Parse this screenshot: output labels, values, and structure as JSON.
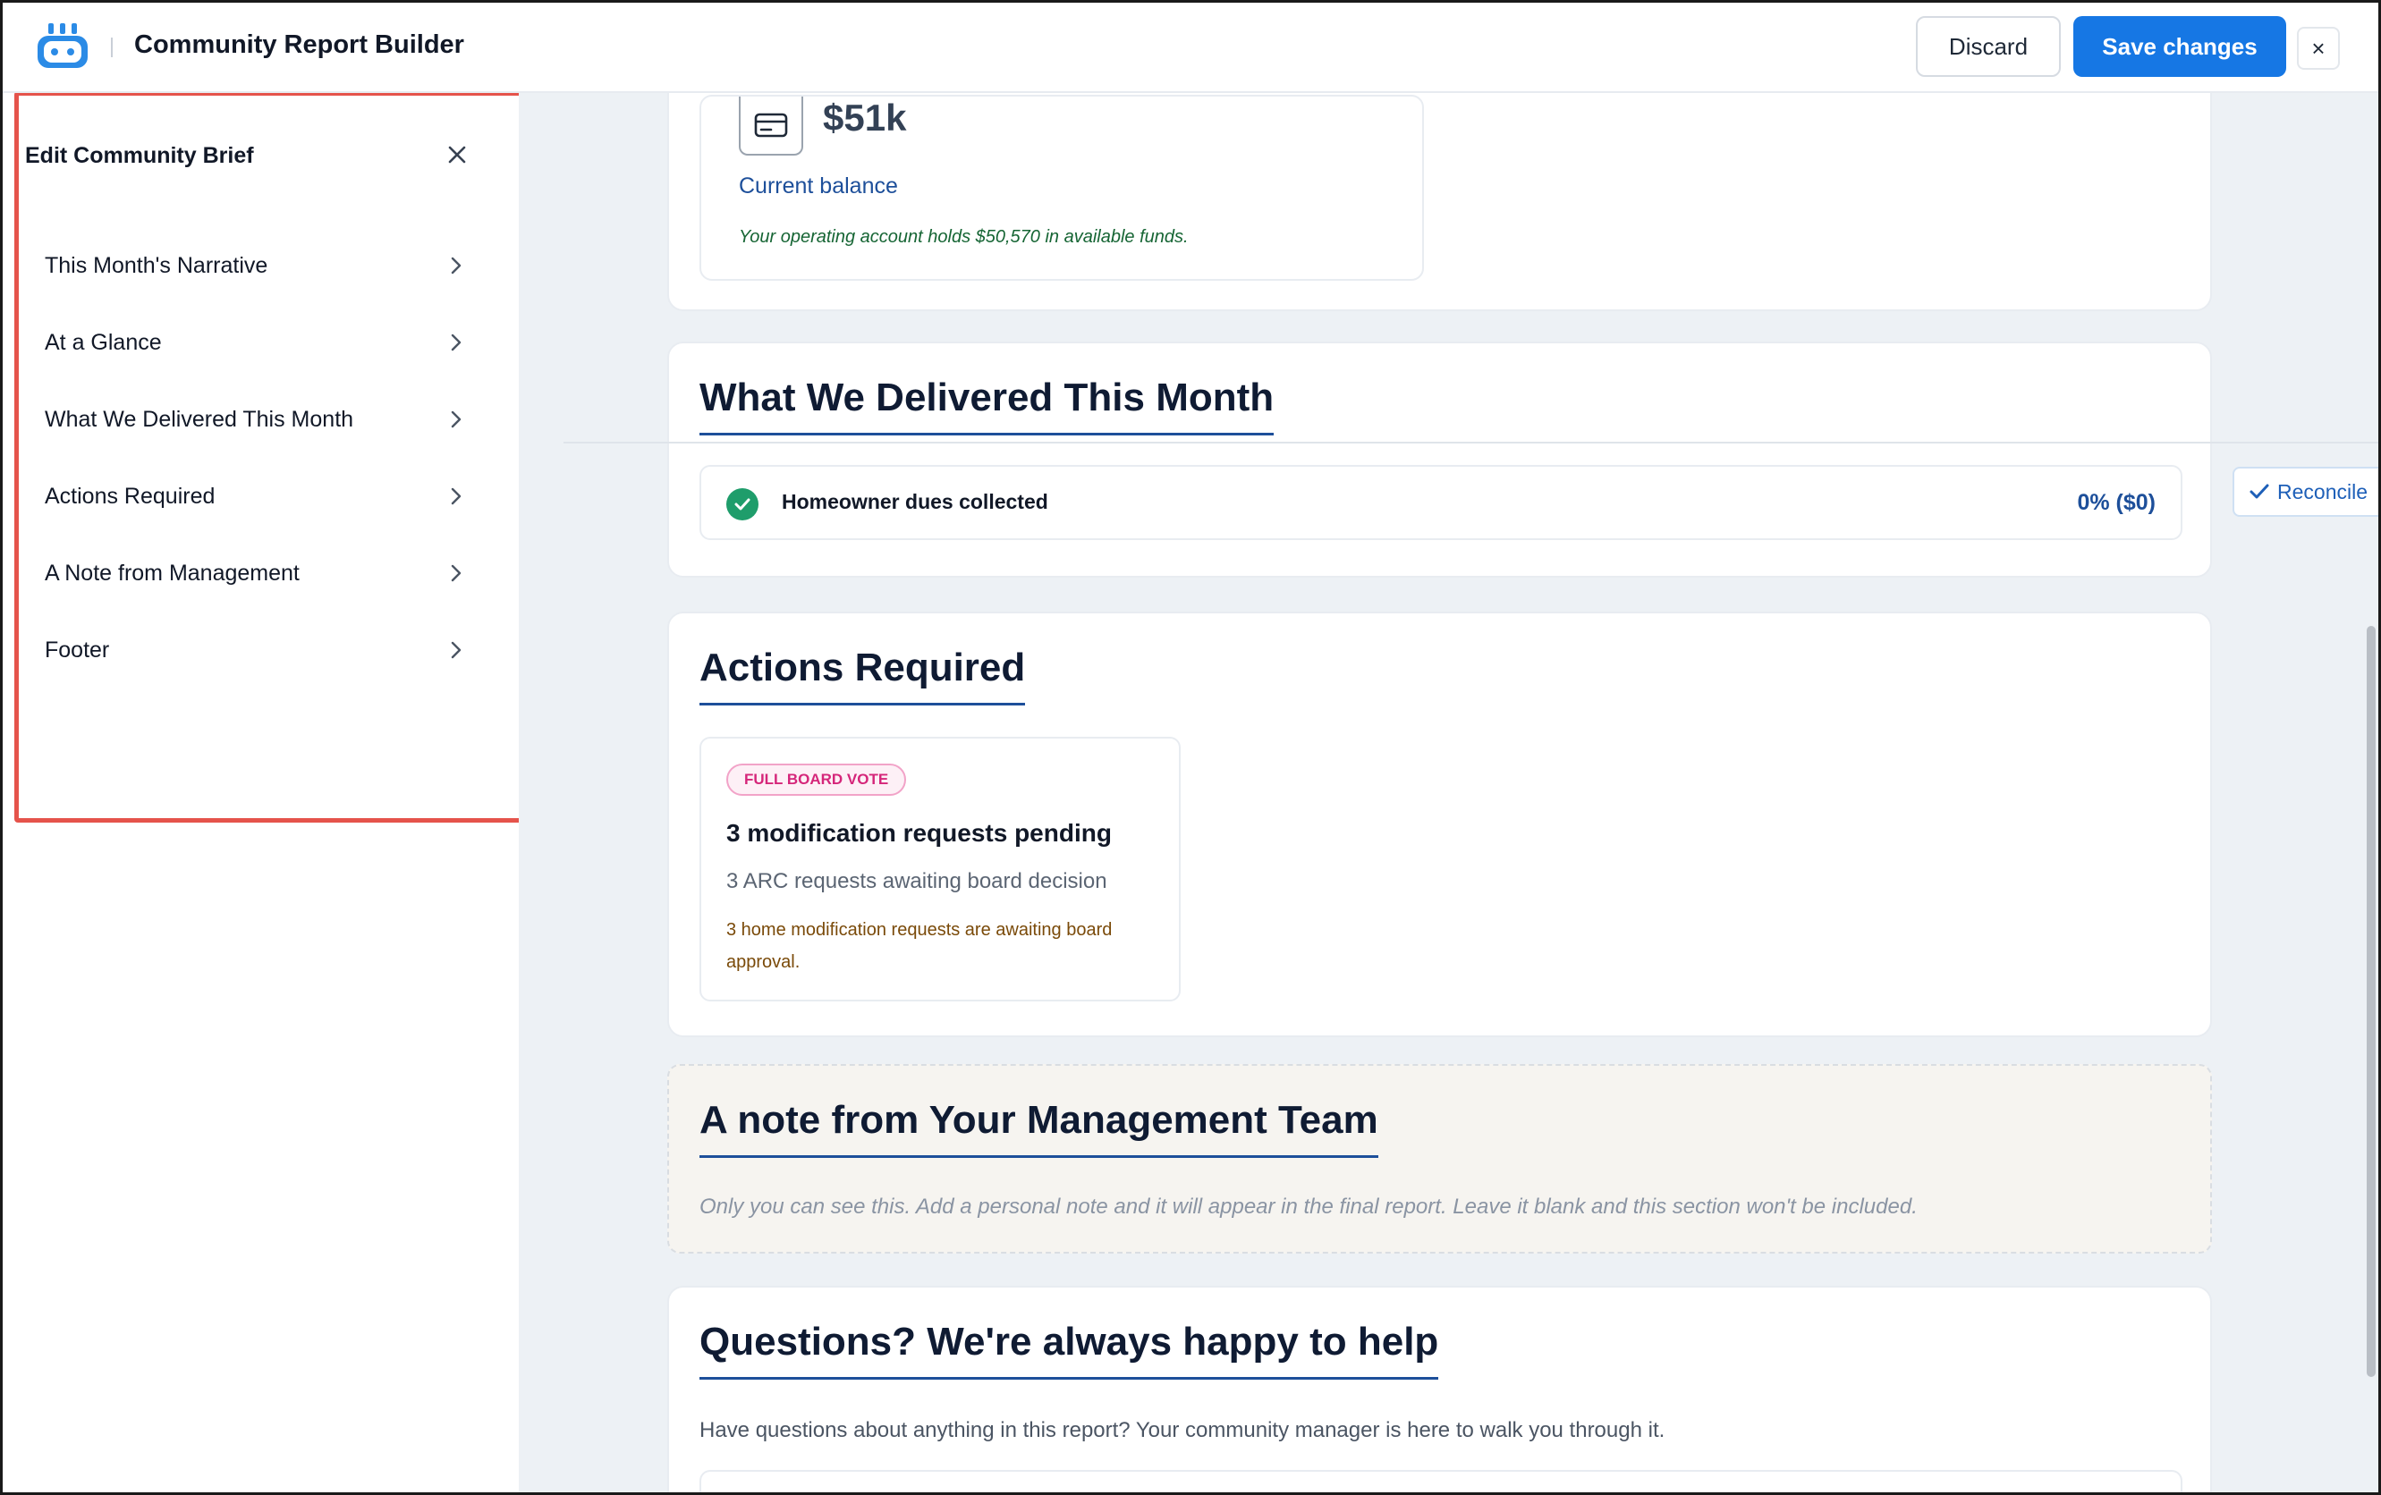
{
  "header": {
    "app_title": "Community Report Builder",
    "discard_label": "Discard",
    "save_label": "Save changes",
    "close_glyph": "×"
  },
  "editor": {
    "title": "Edit Community Brief",
    "items": [
      {
        "label": "This Month's Narrative"
      },
      {
        "label": "At a Glance"
      },
      {
        "label": "What We Delivered This Month"
      },
      {
        "label": "Actions Required"
      },
      {
        "label": "A Note from Management"
      },
      {
        "label": "Footer"
      }
    ]
  },
  "balance": {
    "value": "$51k",
    "label": "Current balance",
    "note": "Your operating account holds $50,570 in available funds."
  },
  "delivered": {
    "title": "What We Delivered This Month",
    "row_label": "Homeowner dues collected",
    "row_value": "0% ($0)",
    "reconcile_label": "Reconcile"
  },
  "actions": {
    "title": "Actions Required",
    "badge": "FULL BOARD VOTE",
    "card_title": "3 modification requests pending",
    "card_sub": "3 ARC requests awaiting board decision",
    "card_note": "3 home modification requests are awaiting board approval."
  },
  "note": {
    "title": "A note from Your Management Team",
    "hint": "Only you can see this. Add a personal note and it will appear in the final report. Leave it blank and this section won't be included."
  },
  "questions": {
    "title": "Questions? We're always happy to help",
    "sub": "Have questions about anything in this report? Your community manager is here to walk you through it."
  },
  "colors": {
    "primary": "#1677e4",
    "heading_underline": "#1d4f9a",
    "highlight_border": "#e5534b",
    "success": "#1f9d6b",
    "badge_pink": "#d5267a"
  }
}
